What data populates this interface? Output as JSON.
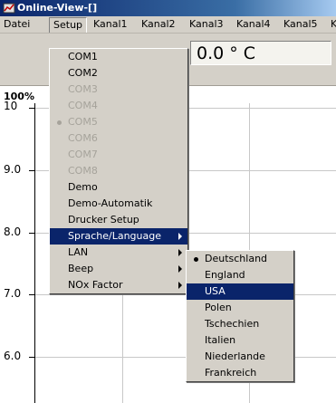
{
  "window": {
    "title": "Online-View-[]",
    "icon": "app-window-icon"
  },
  "menubar": [
    "Datei",
    "Setup",
    "Kanal1",
    "Kanal2",
    "Kanal3",
    "Kanal4",
    "Kanal5",
    "K"
  ],
  "readout": {
    "value": "0.0 ° C"
  },
  "plot": {
    "percent_label": "100%",
    "y_labels": [
      "10",
      "9.0",
      "8.0",
      "7.0",
      "6.0"
    ]
  },
  "setup_menu": {
    "items": [
      {
        "label": "COM1",
        "disabled": false,
        "bullet": false,
        "submenu": false
      },
      {
        "label": "COM2",
        "disabled": false,
        "bullet": false,
        "submenu": false
      },
      {
        "label": "COM3",
        "disabled": true,
        "bullet": false,
        "submenu": false
      },
      {
        "label": "COM4",
        "disabled": true,
        "bullet": false,
        "submenu": false
      },
      {
        "label": "COM5",
        "disabled": true,
        "bullet": true,
        "submenu": false
      },
      {
        "label": "COM6",
        "disabled": true,
        "bullet": false,
        "submenu": false
      },
      {
        "label": "COM7",
        "disabled": true,
        "bullet": false,
        "submenu": false
      },
      {
        "label": "COM8",
        "disabled": true,
        "bullet": false,
        "submenu": false
      },
      {
        "label": "Demo",
        "disabled": false,
        "bullet": false,
        "submenu": false
      },
      {
        "label": "Demo-Automatik",
        "disabled": false,
        "bullet": false,
        "submenu": false
      },
      {
        "label": "Drucker Setup",
        "disabled": false,
        "bullet": false,
        "submenu": false
      },
      {
        "label": "Sprache/Language",
        "disabled": false,
        "bullet": false,
        "submenu": true,
        "selected": true
      },
      {
        "label": "LAN",
        "disabled": false,
        "bullet": false,
        "submenu": true
      },
      {
        "label": "Beep",
        "disabled": false,
        "bullet": false,
        "submenu": true
      },
      {
        "label": "NOx Factor",
        "disabled": false,
        "bullet": false,
        "submenu": true
      }
    ]
  },
  "language_menu": {
    "items": [
      {
        "label": "Deutschland",
        "bullet": true
      },
      {
        "label": "England"
      },
      {
        "label": "USA",
        "selected": true
      },
      {
        "label": "Polen"
      },
      {
        "label": "Tschechien"
      },
      {
        "label": "Italien"
      },
      {
        "label": "Niederlande"
      },
      {
        "label": "Frankreich"
      }
    ]
  },
  "colors": {
    "highlight": "#0a246a",
    "menu_bg": "#d4d0c8",
    "disabled_text": "#a6a39b"
  }
}
